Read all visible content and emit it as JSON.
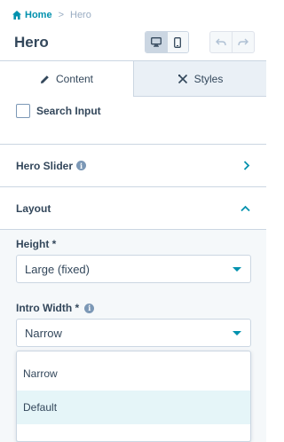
{
  "breadcrumb": {
    "home": "Home",
    "separator": ">",
    "current": "Hero"
  },
  "page": {
    "title": "Hero"
  },
  "toolbar": {
    "device_desktop_icon": "desktop-icon",
    "device_mobile_icon": "mobile-icon",
    "undo_icon": "undo-icon",
    "redo_icon": "redo-icon"
  },
  "tabs": [
    {
      "label": "Content",
      "icon": "pencil-icon",
      "active": true
    },
    {
      "label": "Styles",
      "icon": "styles-icon",
      "active": false
    }
  ],
  "fields": {
    "search_input": {
      "label": "Search Input",
      "checked": false
    }
  },
  "sections": [
    {
      "label": "Hero Slider",
      "expanded": false
    },
    {
      "label": "Layout",
      "expanded": true
    }
  ],
  "layout": {
    "height_label": "Height *",
    "height_value": "Large (fixed)",
    "intro_width_label": "Intro Width *",
    "intro_width_value": "Narrow",
    "options": [
      "Narrow",
      "Default"
    ]
  },
  "colors": {
    "accent": "#0091ae",
    "text": "#33475b",
    "border": "#cbd6e2",
    "highlight": "#e5f5f8"
  }
}
